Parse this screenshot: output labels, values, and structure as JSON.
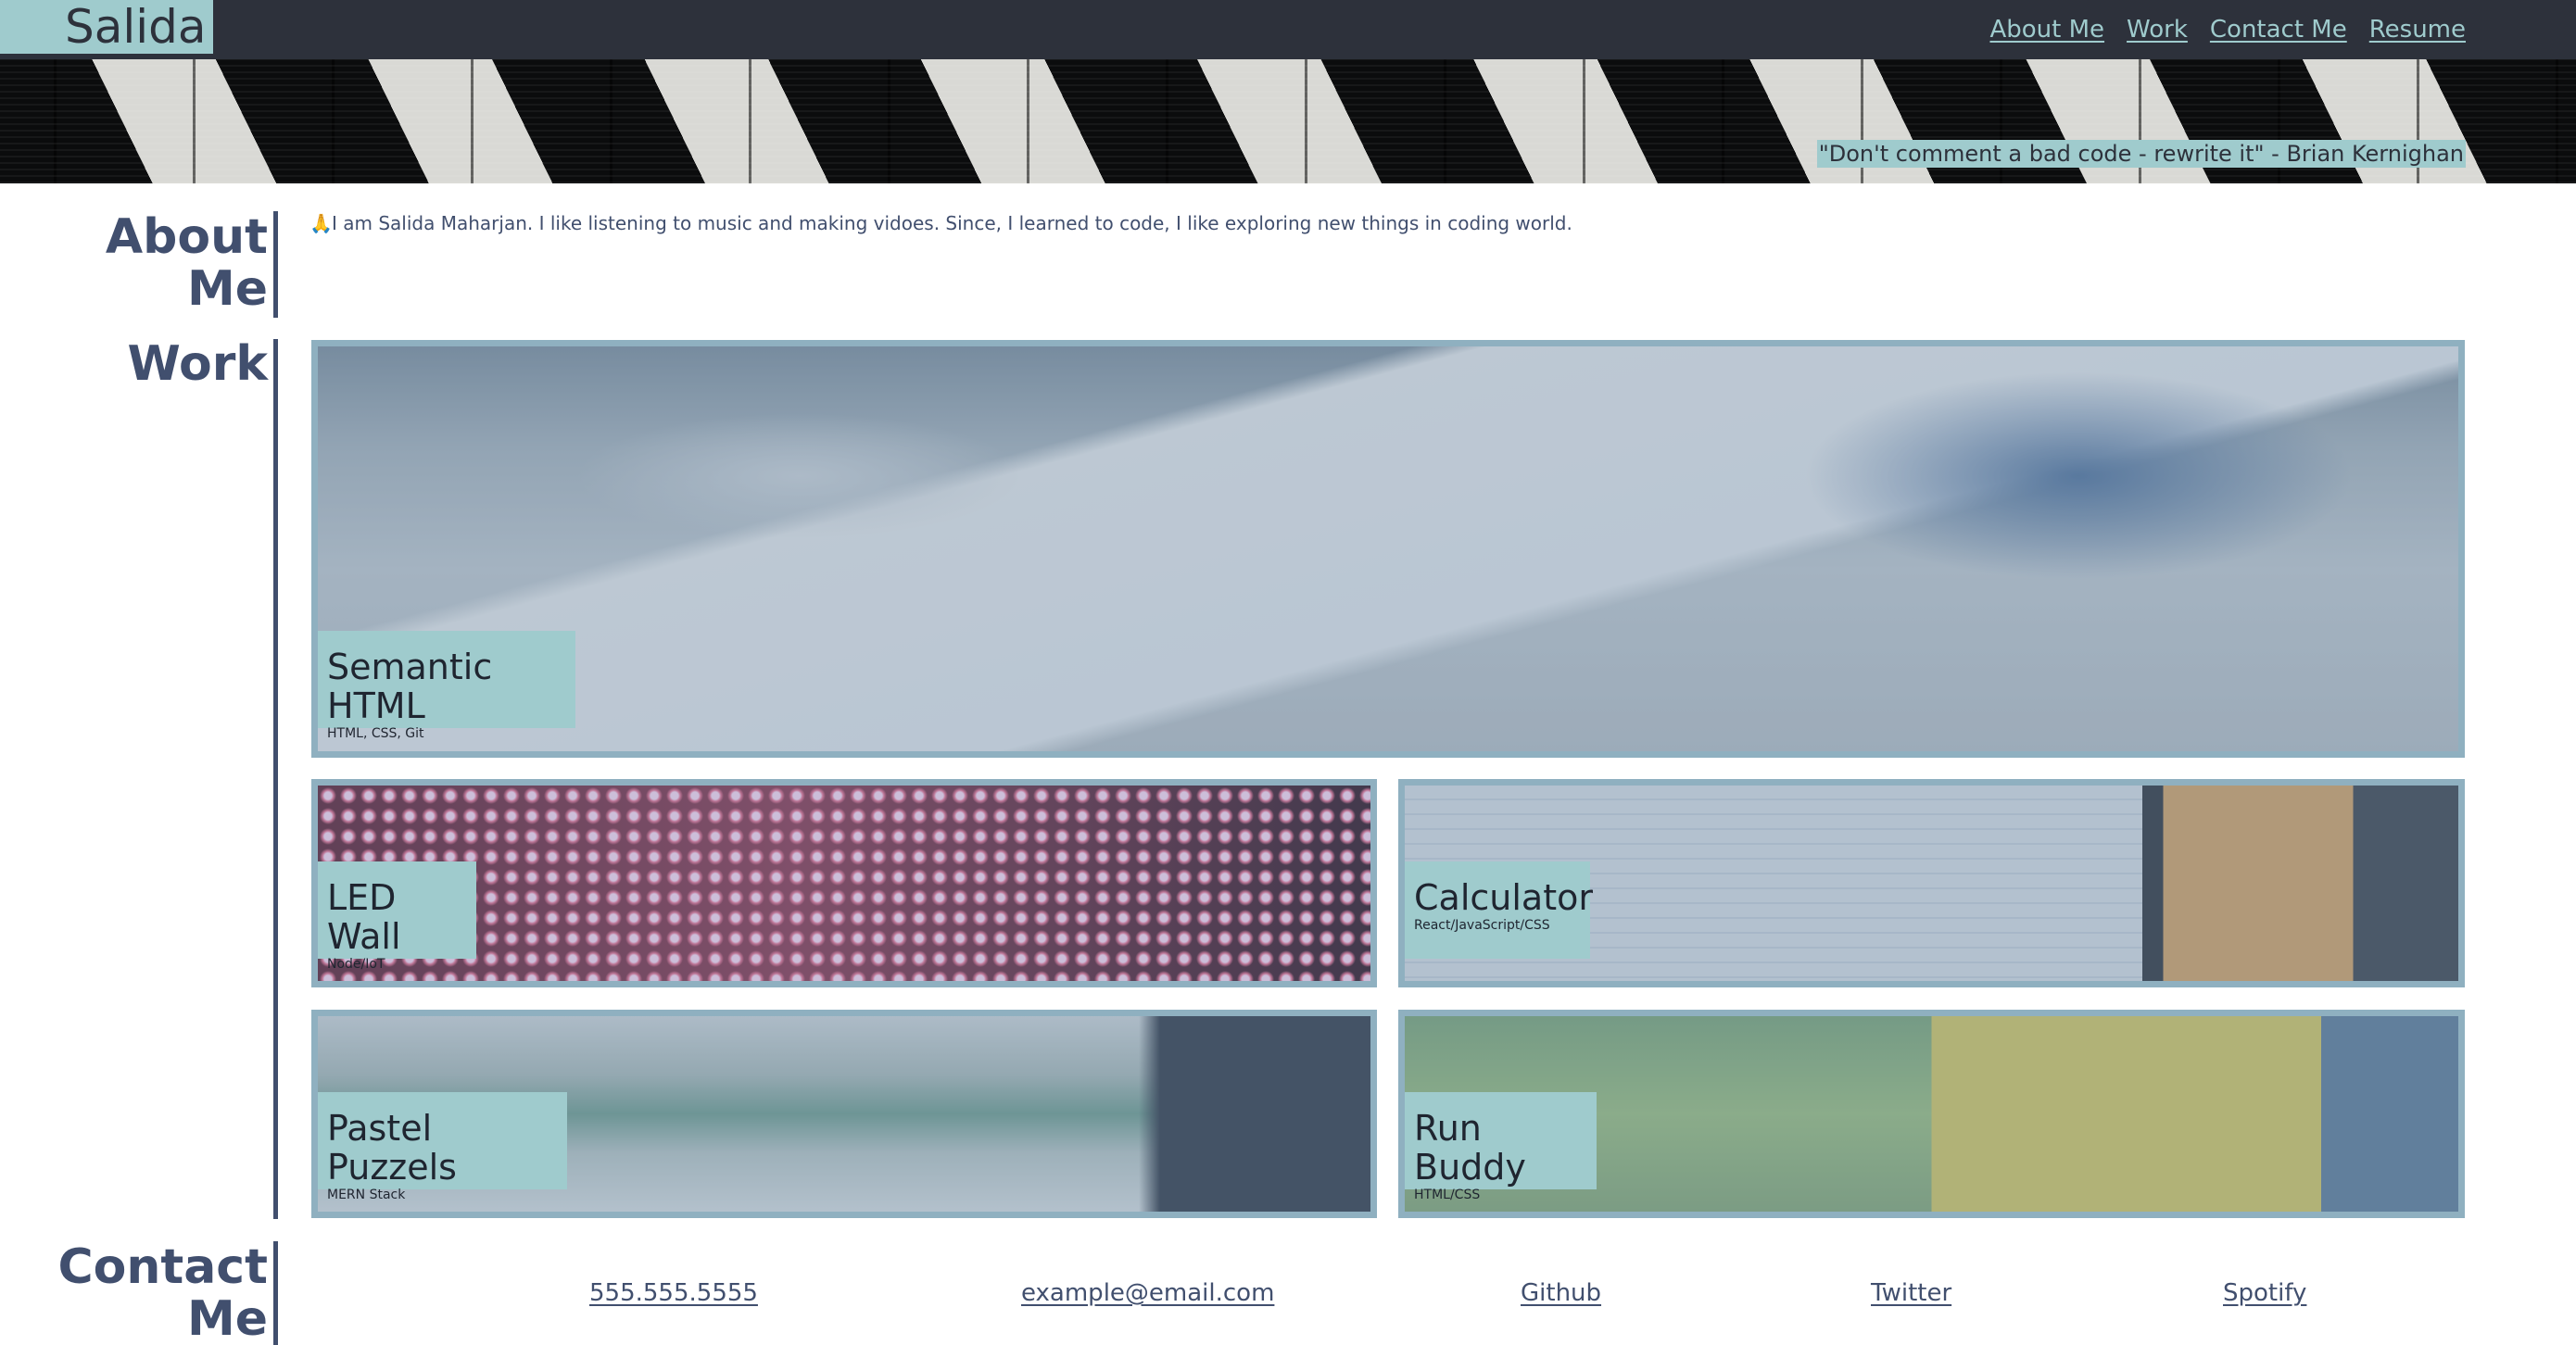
{
  "header": {
    "brand": "Salida",
    "nav": [
      "About Me",
      "Work",
      "Contact Me",
      "Resume"
    ]
  },
  "hero": {
    "quote": "\"Don't comment a bad code - rewrite it\" - Brian Kernighan"
  },
  "about": {
    "heading_line1": "About",
    "heading_line2": "Me",
    "emoji": "🙏",
    "text": "I am Salida Maharjan. I like listening to music and making vidoes. Since, I learned to code, I like exploring new things in coding world."
  },
  "work": {
    "heading": "Work",
    "projects": [
      {
        "title": "Semantic HTML",
        "tech": "HTML, CSS, Git"
      },
      {
        "title": "LED Wall",
        "tech": "Node/IoT"
      },
      {
        "title": "Calculator",
        "tech": "React/JavaScript/CSS"
      },
      {
        "title": "Pastel Puzzels",
        "tech": "MERN Stack"
      },
      {
        "title": "Run Buddy",
        "tech": "HTML/CSS"
      }
    ]
  },
  "contact": {
    "heading_line1": "Contact",
    "heading_line2": "Me",
    "links": [
      "555.555.5555",
      "example@email.com",
      "Github",
      "Twitter",
      "Spotify"
    ]
  },
  "colors": {
    "nav_bg": "#2d313b",
    "accent": "#9fcbcd",
    "text": "#414f6e",
    "card_border": "#8fb0c0"
  }
}
